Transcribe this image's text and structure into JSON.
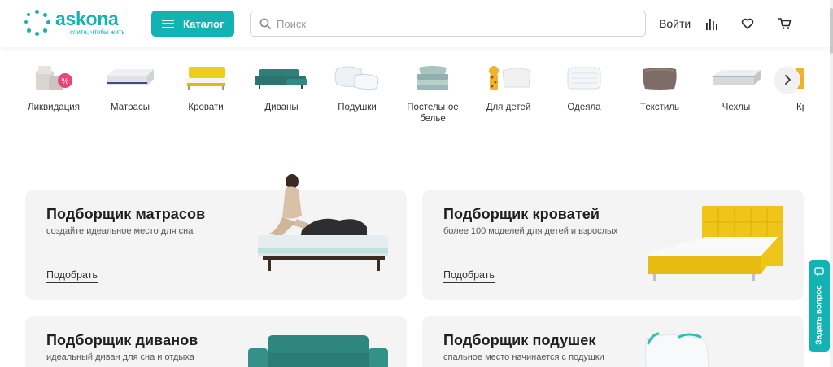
{
  "brand": {
    "name": "askona",
    "slogan": "спите, чтобы жить",
    "color": "#14b3b3"
  },
  "header": {
    "catalog_label": "Каталог",
    "search_placeholder": "Поиск",
    "login_label": "Войти",
    "icons": [
      "compare-icon",
      "heart-icon",
      "cart-icon"
    ]
  },
  "categories": [
    {
      "label": "Ликвидация",
      "icon": "liquidation-icon"
    },
    {
      "label": "Матрасы",
      "icon": "mattress-icon"
    },
    {
      "label": "Кровати",
      "icon": "bed-icon"
    },
    {
      "label": "Диваны",
      "icon": "sofa-icon"
    },
    {
      "label": "Подушки",
      "icon": "pillow-icon"
    },
    {
      "label": "Постельное белье",
      "icon": "bedding-icon"
    },
    {
      "label": "Для детей",
      "icon": "kids-icon"
    },
    {
      "label": "Одеяла",
      "icon": "blanket-icon"
    },
    {
      "label": "Текстиль",
      "icon": "textile-icon"
    },
    {
      "label": "Чехлы",
      "icon": "cover-icon"
    },
    {
      "label": "Кр",
      "icon": "partial-icon"
    }
  ],
  "selectors": [
    {
      "title": "Подборщик матрасов",
      "subtitle": "создайте идеальное место для сна",
      "link": "Подобрать"
    },
    {
      "title": "Подборщик кроватей",
      "subtitle": "более 100 моделей для детей и взрослых",
      "link": "Подобрать"
    },
    {
      "title": "Подборщик диванов",
      "subtitle": "идеальный диван для сна и отдыха"
    },
    {
      "title": "Подборщик подушек",
      "subtitle": "спальное место начинается с подушки"
    }
  ],
  "ask_question": "Задать вопрос"
}
